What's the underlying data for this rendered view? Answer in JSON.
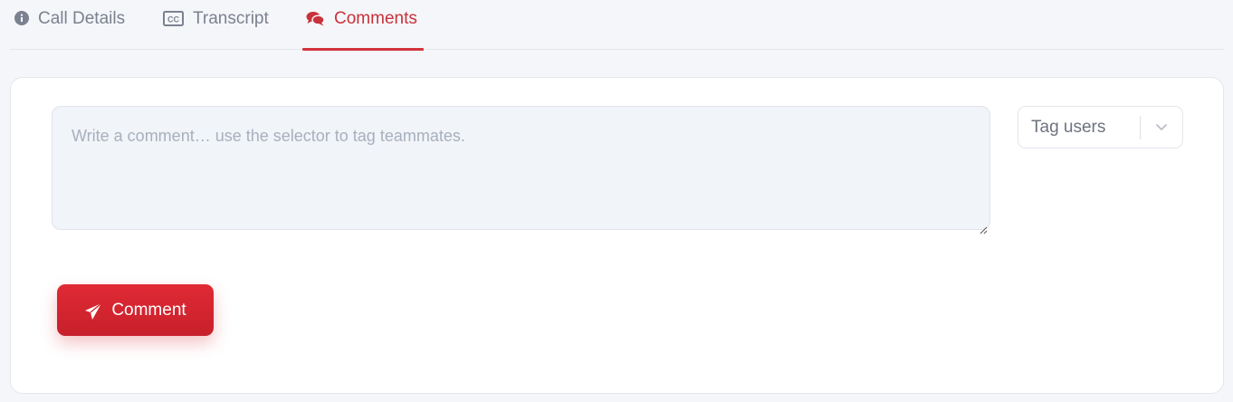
{
  "tabs": [
    {
      "label": "Call Details",
      "icon": "info-circle-icon",
      "active": false
    },
    {
      "label": "Transcript",
      "icon": "closed-captions-icon",
      "active": false
    },
    {
      "label": "Comments",
      "icon": "comments-icon",
      "active": true
    }
  ],
  "comment_form": {
    "placeholder": "Write a comment… use the selector to tag teammates.",
    "value": "",
    "tag_select": {
      "label": "Tag users",
      "icon": "chevron-down-icon"
    },
    "submit": {
      "label": "Comment",
      "icon": "paper-plane-icon"
    }
  },
  "colors": {
    "accent": "#d3343d",
    "button": "#d9262f",
    "background": "#f5f6f9",
    "input_bg": "#f1f4f8"
  }
}
